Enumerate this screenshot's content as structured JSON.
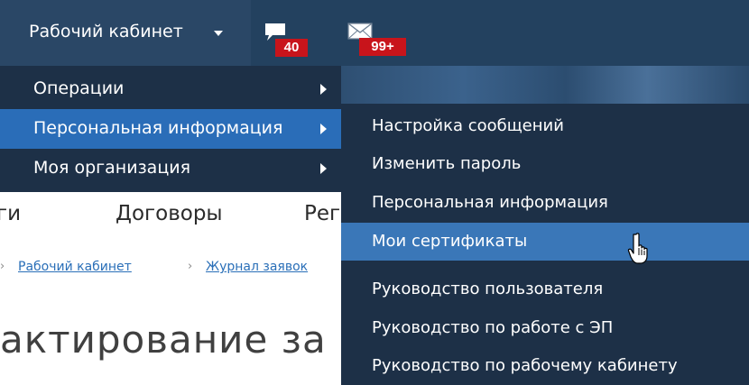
{
  "topbar": {
    "cabinet_label": "Рабочий кабинет",
    "messages_badge": "40",
    "mail_badge": "99+"
  },
  "menu": {
    "items": [
      {
        "label": "Операции",
        "has_submenu": true,
        "active": false
      },
      {
        "label": "Персональная информация",
        "has_submenu": true,
        "active": true
      },
      {
        "label": "Моя организация",
        "has_submenu": true,
        "active": false
      }
    ]
  },
  "submenu": {
    "items": [
      {
        "label": "Настройка сообщений"
      },
      {
        "label": "Изменить пароль"
      },
      {
        "label": "Персональная информация"
      },
      {
        "label": "Мои сертификаты",
        "hovered": true
      },
      {
        "label": "Руководство пользователя"
      },
      {
        "label": "Руководство по работе с ЭП"
      },
      {
        "label": "Руководство по рабочему кабинету"
      }
    ]
  },
  "nav": {
    "items": [
      "ги",
      "Договоры",
      "Рег"
    ]
  },
  "breadcrumb": {
    "items": [
      "Рабочий кабинет",
      "Журнал заявок"
    ]
  },
  "page": {
    "title": "актирование за"
  },
  "colors": {
    "topbar": "#23415f",
    "menu_bg": "#1d3047",
    "active_item": "#2a6db8",
    "hovered_item": "#3a77b8",
    "badge": "#c8141b",
    "link": "#2a6fb8"
  }
}
